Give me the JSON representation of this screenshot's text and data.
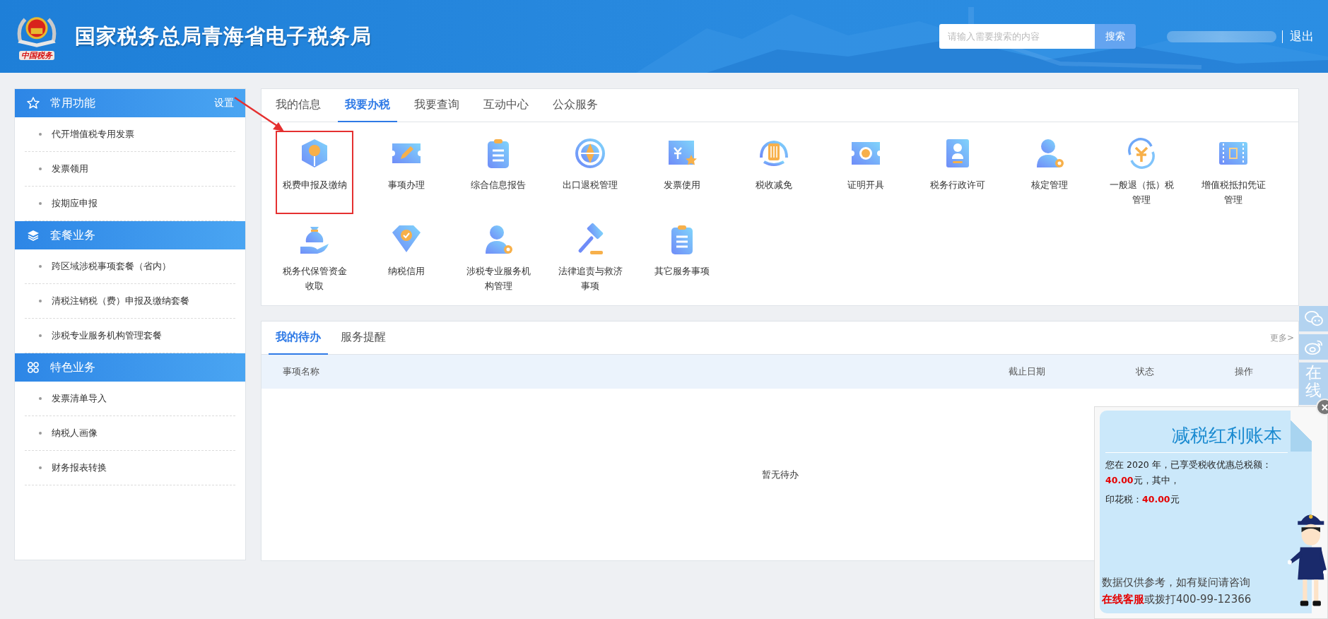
{
  "header": {
    "title": "国家税务总局青海省电子税务局",
    "logo_caption": "中国税务",
    "search": {
      "placeholder": "请输入需要搜索的内容",
      "button": "搜索"
    },
    "logout": "退出"
  },
  "sidebar": [
    {
      "title": "常用功能",
      "action": "设置",
      "items": [
        "代开增值税专用发票",
        "发票领用",
        "按期应申报"
      ]
    },
    {
      "title": "套餐业务",
      "items": [
        "跨区域涉税事项套餐（省内）",
        "清税注销税（费）申报及缴纳套餐",
        "涉税专业服务机构管理套餐"
      ]
    },
    {
      "title": "特色业务",
      "items": [
        "发票清单导入",
        "纳税人画像",
        "财务报表转换"
      ]
    }
  ],
  "tabs": [
    {
      "label": "我的信息",
      "selected": false
    },
    {
      "label": "我要办税",
      "selected": true
    },
    {
      "label": "我要查询",
      "selected": false
    },
    {
      "label": "互动中心",
      "selected": false
    },
    {
      "label": "公众服务",
      "selected": false
    }
  ],
  "services": [
    {
      "label": "税费申报及缴纳",
      "highlighted": true
    },
    {
      "label": "事项办理",
      "highlighted": false
    },
    {
      "label": "综合信息报告",
      "highlighted": false
    },
    {
      "label": "出口退税管理",
      "highlighted": false
    },
    {
      "label": "发票使用",
      "highlighted": false
    },
    {
      "label": "税收减免",
      "highlighted": false
    },
    {
      "label": "证明开具",
      "highlighted": false
    },
    {
      "label": "税务行政许可",
      "highlighted": false
    },
    {
      "label": "核定管理",
      "highlighted": false
    },
    {
      "label": "一般退（抵）税管理",
      "highlighted": false
    },
    {
      "label": "增值税抵扣凭证管理",
      "highlighted": false
    },
    {
      "label": "税务代保管资金收取",
      "highlighted": false
    },
    {
      "label": "纳税信用",
      "highlighted": false
    },
    {
      "label": "涉税专业服务机构管理",
      "highlighted": false
    },
    {
      "label": "法律追责与救济事项",
      "highlighted": false
    },
    {
      "label": "其它服务事项",
      "highlighted": false
    }
  ],
  "tasks": {
    "tabs": [
      {
        "label": "我的待办",
        "selected": true
      },
      {
        "label": "服务提醒",
        "selected": false
      }
    ],
    "more": "更多>",
    "columns": [
      "事项名称",
      "截止日期",
      "状态",
      "操作"
    ],
    "empty": "暂无待办"
  },
  "side_bar": {
    "chat_label": "在线"
  },
  "popup": {
    "title": "减税红利账本",
    "lines": [
      "您在 2020 年，已享受税收优惠总税额：",
      "**40.00**元，其中，",
      "印花税：**40.00**元"
    ],
    "footer": [
      "数据仅供参考，如有疑问请咨询",
      "**在线客服**或拨打400-99-12366"
    ]
  }
}
